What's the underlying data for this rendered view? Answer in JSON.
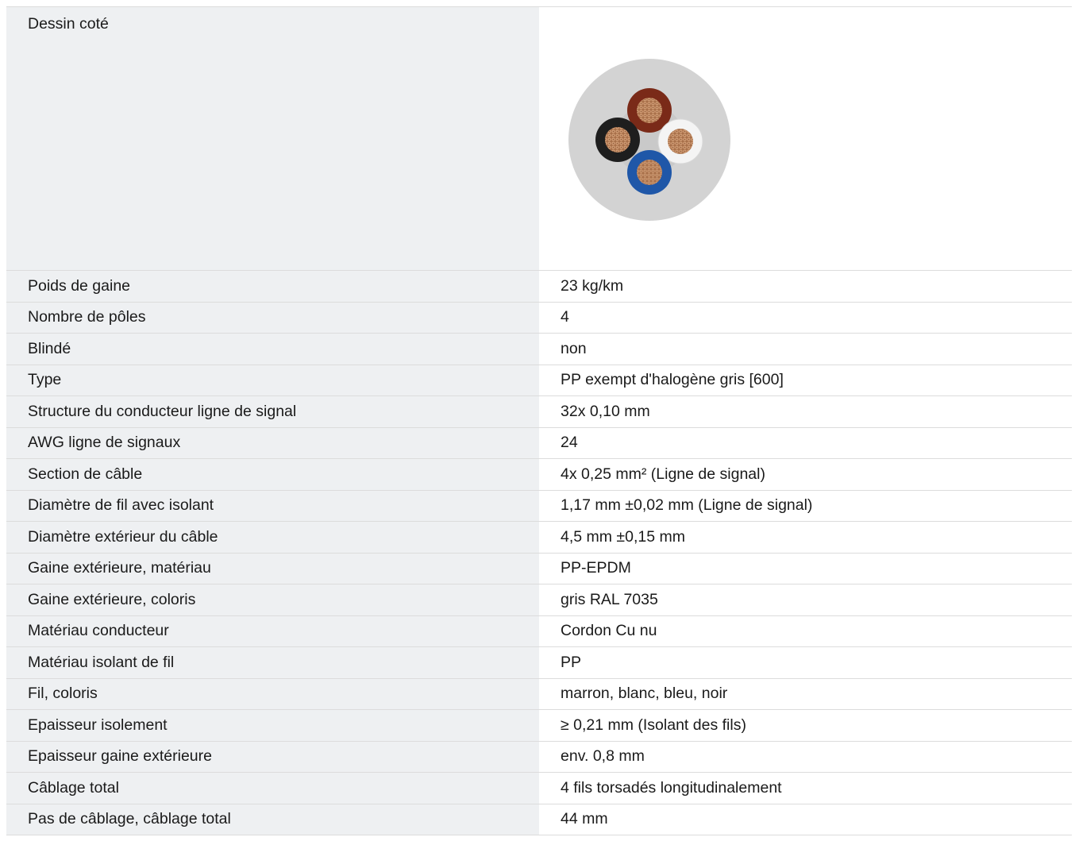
{
  "drawing": {
    "label": "Dessin coté",
    "image": "cable-cross-section",
    "colors": {
      "sheath": "#d3d3d3",
      "brown": "#7a2a18",
      "white": "#f4f4f4",
      "blue": "#1f57a8",
      "black": "#1e1e1e",
      "copper": "#b07a52"
    }
  },
  "specs": [
    {
      "label": "Poids de gaine",
      "value": "23 kg/km"
    },
    {
      "label": "Nombre de pôles",
      "value": "4"
    },
    {
      "label": "Blindé",
      "value": "non"
    },
    {
      "label": "Type",
      "value": "PP exempt d'halogène gris [600]"
    },
    {
      "label": "Structure du conducteur ligne de signal",
      "value": "32x 0,10 mm"
    },
    {
      "label": "AWG ligne de signaux",
      "value": "24"
    },
    {
      "label": "Section de câble",
      "value": "4x 0,25 mm² (Ligne de signal)"
    },
    {
      "label": "Diamètre de fil avec isolant",
      "value": "1,17 mm ±0,02 mm (Ligne de signal)"
    },
    {
      "label": "Diamètre extérieur du câble",
      "value": "4,5 mm ±0,15 mm"
    },
    {
      "label": "Gaine extérieure, matériau",
      "value": "PP-EPDM"
    },
    {
      "label": "Gaine extérieure, coloris",
      "value": "gris RAL 7035"
    },
    {
      "label": "Matériau conducteur",
      "value": "Cordon Cu nu"
    },
    {
      "label": "Matériau isolant de fil",
      "value": "PP"
    },
    {
      "label": "Fil, coloris",
      "value": "marron, blanc, bleu, noir"
    },
    {
      "label": "Epaisseur isolement",
      "value": "≥ 0,21 mm (Isolant des fils)"
    },
    {
      "label": "Epaisseur gaine extérieure",
      "value": "env. 0,8 mm"
    },
    {
      "label": "Câblage total",
      "value": "4 fils torsadés longitudinalement"
    },
    {
      "label": "Pas de câblage, câblage total",
      "value": "44 mm"
    }
  ]
}
